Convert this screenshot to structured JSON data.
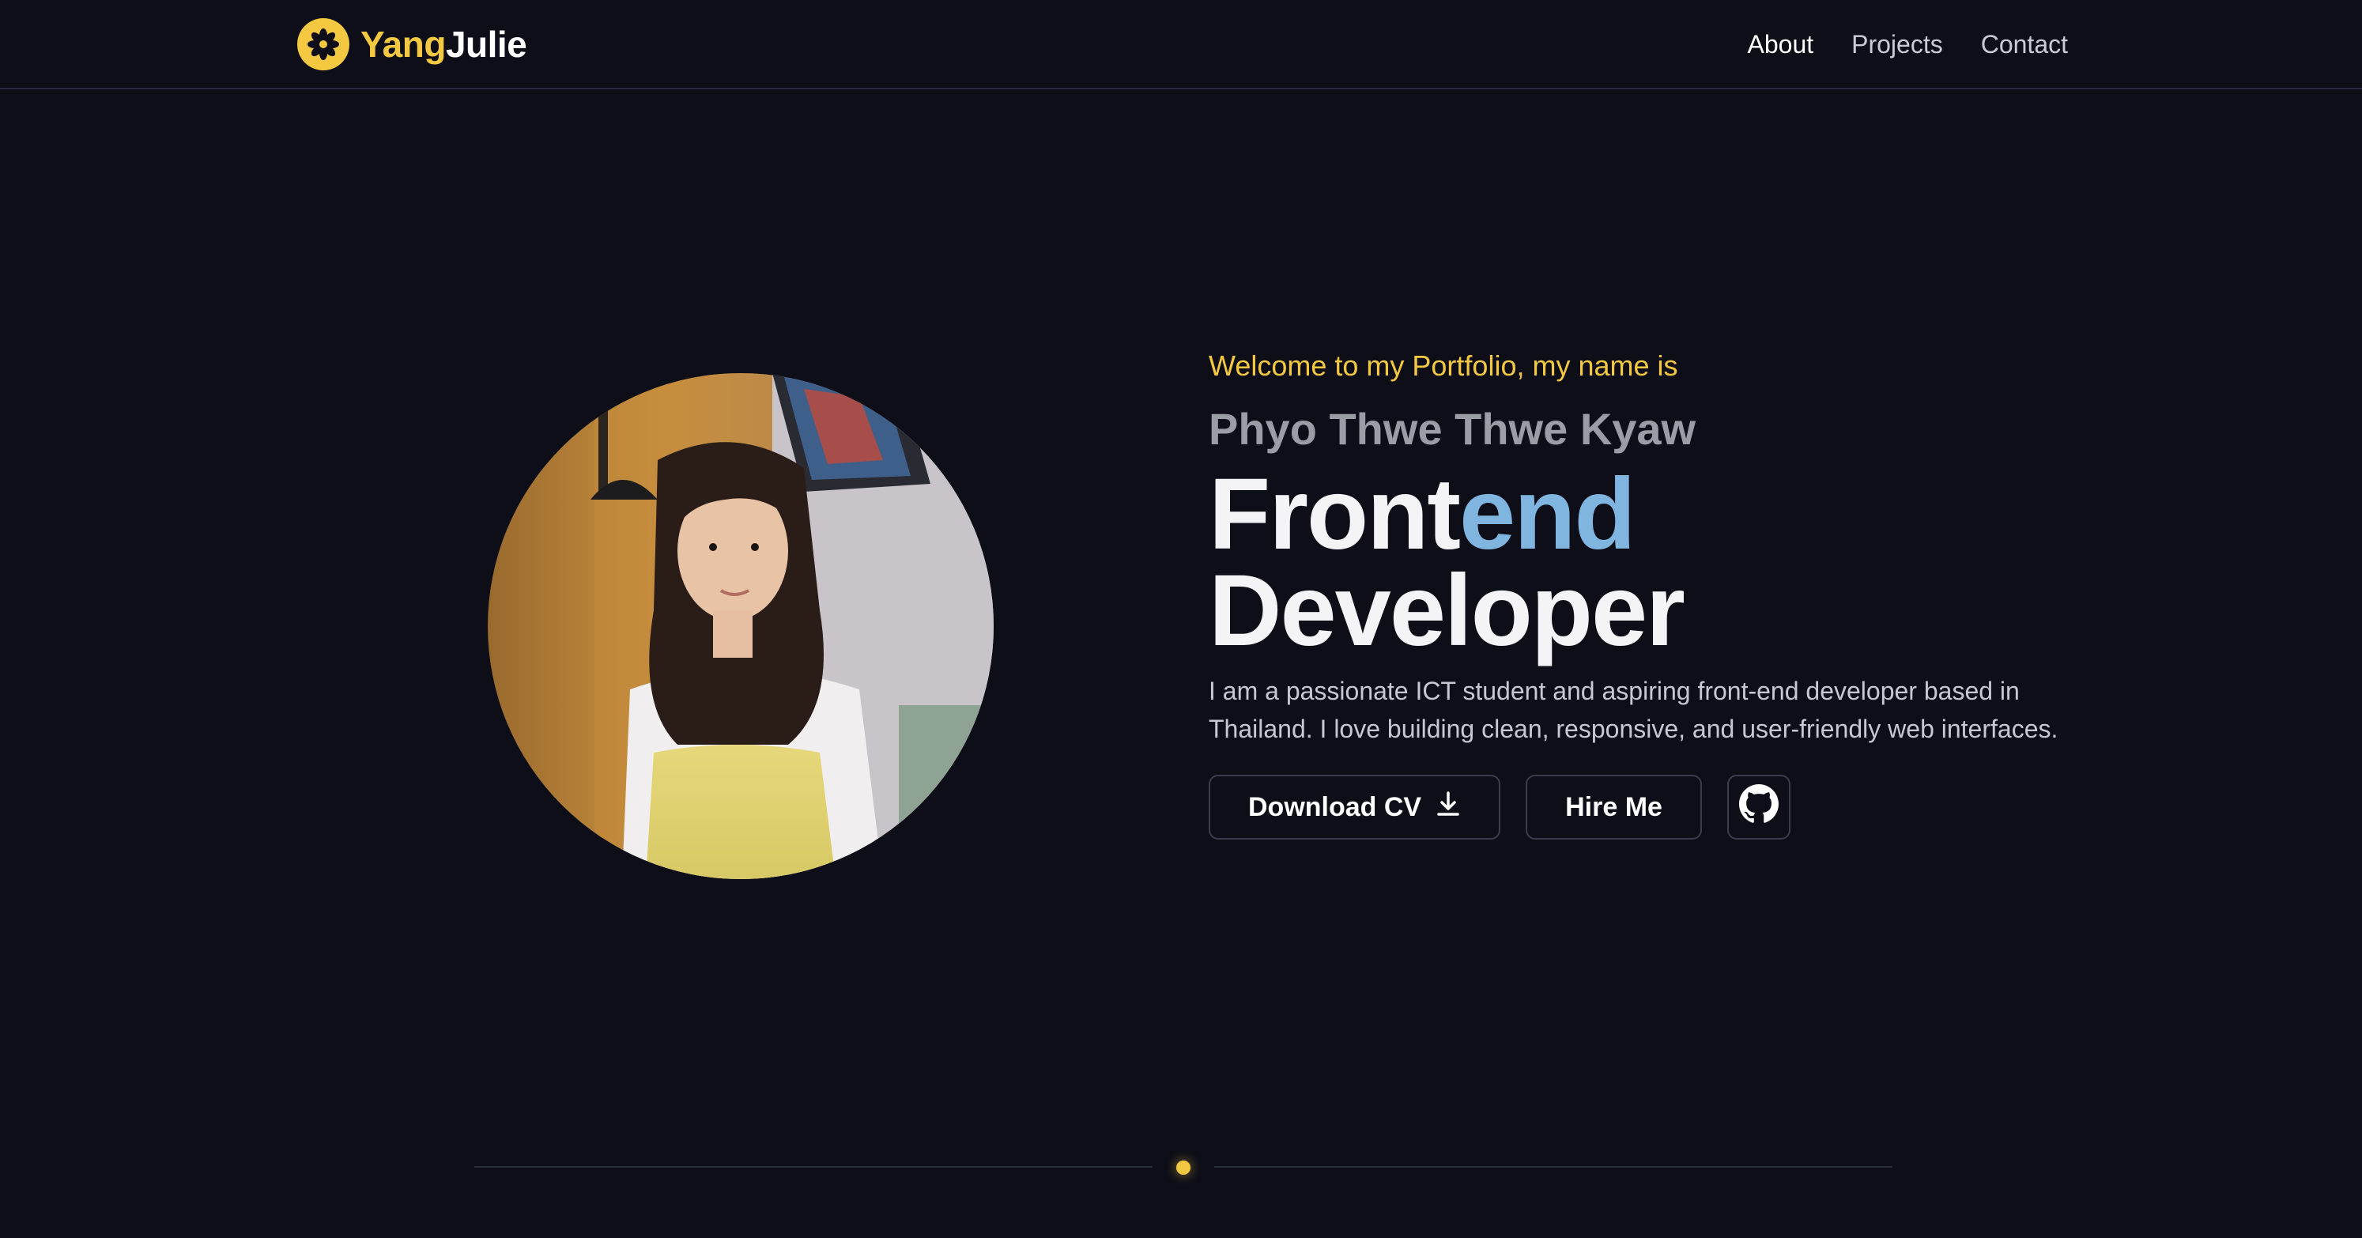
{
  "brand": {
    "part1": "Yang",
    "part2": "Julie",
    "logo_icon": "flower-icon",
    "accent": "#f5c842"
  },
  "nav": {
    "items": [
      {
        "label": "About",
        "active": true
      },
      {
        "label": "Projects",
        "active": false
      },
      {
        "label": "Contact",
        "active": false
      }
    ]
  },
  "hero": {
    "welcome": "Welcome to my Portfolio, my name is",
    "name": "Phyo Thwe Thwe Kyaw",
    "title_part1": "Front",
    "title_part2": "end",
    "title_part3": "Developer",
    "description": "I am a passionate ICT student and aspiring front-end developer based in Thailand. I love building clean, responsive, and user-friendly web interfaces.",
    "buttons": {
      "download_cv": "Download CV",
      "download_icon": "download-icon",
      "hire_me": "Hire Me",
      "github_icon": "github-icon"
    },
    "title_accent": "#7fb5de"
  },
  "colors": {
    "background": "#0d0e18",
    "border": "#3a3d4e"
  }
}
